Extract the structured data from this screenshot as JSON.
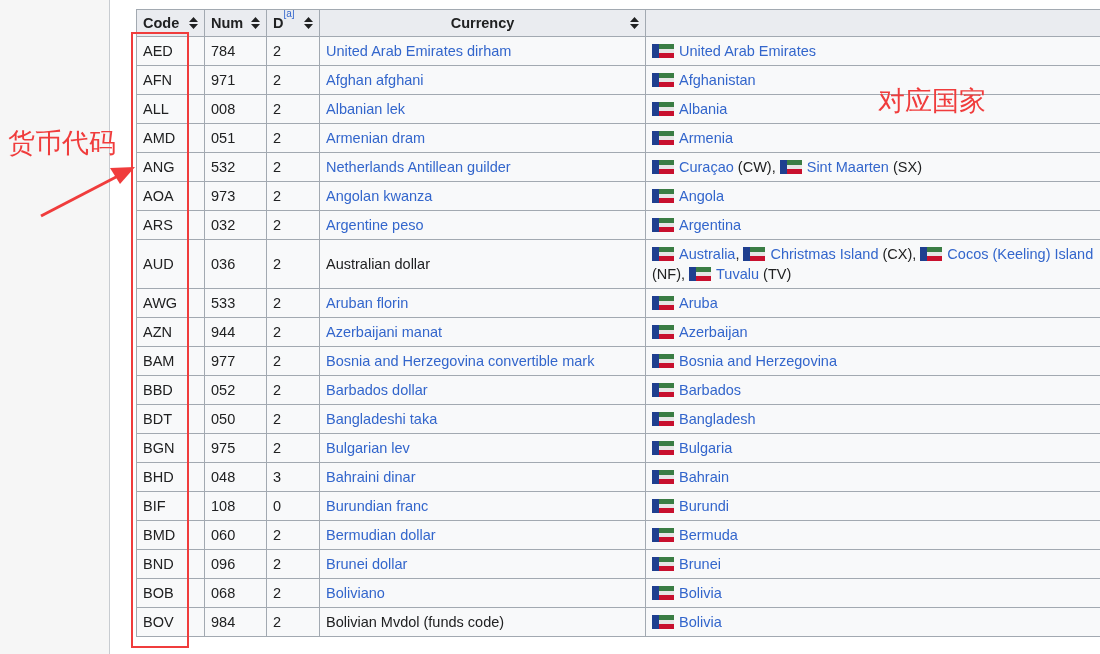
{
  "table": {
    "columns": [
      {
        "label": "Code",
        "sortable": true
      },
      {
        "label": "Num",
        "sortable": true
      },
      {
        "label": "D",
        "note": "[a]",
        "sortable": true
      },
      {
        "label": "Currency",
        "sortable": true
      },
      {
        "sortable": false
      }
    ],
    "rows": [
      {
        "code": "AED",
        "num": "784",
        "d": "2",
        "currency": "United Arab Emirates dirham",
        "link": true,
        "lines": [
          [
            {
              "name": "United Arab Emirates"
            }
          ]
        ]
      },
      {
        "code": "AFN",
        "num": "971",
        "d": "2",
        "currency": "Afghan afghani",
        "link": true,
        "lines": [
          [
            {
              "name": "Afghanistan"
            }
          ]
        ]
      },
      {
        "code": "ALL",
        "num": "008",
        "d": "2",
        "currency": "Albanian lek",
        "link": true,
        "lines": [
          [
            {
              "name": "Albania"
            }
          ]
        ]
      },
      {
        "code": "AMD",
        "num": "051",
        "d": "2",
        "currency": "Armenian dram",
        "link": true,
        "lines": [
          [
            {
              "name": "Armenia"
            }
          ]
        ]
      },
      {
        "code": "ANG",
        "num": "532",
        "d": "2",
        "currency": "Netherlands Antillean guilder",
        "link": true,
        "lines": [
          [
            {
              "name": "Curaçao",
              "note": "(CW)",
              "sep": ","
            },
            {
              "name": "Sint Maarten",
              "note": "(SX)"
            }
          ]
        ]
      },
      {
        "code": "AOA",
        "num": "973",
        "d": "2",
        "currency": "Angolan kwanza",
        "link": true,
        "lines": [
          [
            {
              "name": "Angola"
            }
          ]
        ]
      },
      {
        "code": "ARS",
        "num": "032",
        "d": "2",
        "currency": "Argentine peso",
        "link": true,
        "lines": [
          [
            {
              "name": "Argentina"
            }
          ]
        ]
      },
      {
        "code": "AUD",
        "num": "036",
        "d": "2",
        "currency": "Australian dollar",
        "link": false,
        "lines": [
          [
            {
              "name": "Australia",
              "sep": ","
            },
            {
              "name": "Christmas Island",
              "note": "(CX)",
              "sep": ","
            },
            {
              "name": "Cocos (Keeling) Island"
            }
          ],
          [
            {
              "note": "(NF)",
              "sep": ","
            },
            {
              "name": "Tuvalu",
              "note": "(TV)"
            }
          ]
        ]
      },
      {
        "code": "AWG",
        "num": "533",
        "d": "2",
        "currency": "Aruban florin",
        "link": true,
        "lines": [
          [
            {
              "name": "Aruba"
            }
          ]
        ]
      },
      {
        "code": "AZN",
        "num": "944",
        "d": "2",
        "currency": "Azerbaijani manat",
        "link": true,
        "lines": [
          [
            {
              "name": "Azerbaijan"
            }
          ]
        ]
      },
      {
        "code": "BAM",
        "num": "977",
        "d": "2",
        "currency": "Bosnia and Herzegovina convertible mark",
        "link": true,
        "lines": [
          [
            {
              "name": "Bosnia and Herzegovina"
            }
          ]
        ]
      },
      {
        "code": "BBD",
        "num": "052",
        "d": "2",
        "currency": "Barbados dollar",
        "link": true,
        "lines": [
          [
            {
              "name": "Barbados"
            }
          ]
        ]
      },
      {
        "code": "BDT",
        "num": "050",
        "d": "2",
        "currency": "Bangladeshi taka",
        "link": true,
        "lines": [
          [
            {
              "name": "Bangladesh"
            }
          ]
        ]
      },
      {
        "code": "BGN",
        "num": "975",
        "d": "2",
        "currency": "Bulgarian lev",
        "link": true,
        "lines": [
          [
            {
              "name": "Bulgaria"
            }
          ]
        ]
      },
      {
        "code": "BHD",
        "num": "048",
        "d": "3",
        "currency": "Bahraini dinar",
        "link": true,
        "lines": [
          [
            {
              "name": "Bahrain"
            }
          ]
        ]
      },
      {
        "code": "BIF",
        "num": "108",
        "d": "0",
        "currency": "Burundian franc",
        "link": true,
        "lines": [
          [
            {
              "name": "Burundi"
            }
          ]
        ]
      },
      {
        "code": "BMD",
        "num": "060",
        "d": "2",
        "currency": "Bermudian dollar",
        "link": true,
        "lines": [
          [
            {
              "name": "Bermuda"
            }
          ]
        ]
      },
      {
        "code": "BND",
        "num": "096",
        "d": "2",
        "currency": "Brunei dollar",
        "link": true,
        "lines": [
          [
            {
              "name": "Brunei"
            }
          ]
        ]
      },
      {
        "code": "BOB",
        "num": "068",
        "d": "2",
        "currency": "Boliviano",
        "link": true,
        "lines": [
          [
            {
              "name": "Bolivia"
            }
          ]
        ]
      },
      {
        "code": "BOV",
        "num": "984",
        "d": "2",
        "currency": "Bolivian Mvdol (funds code)",
        "link": false,
        "lines": [
          [
            {
              "name": "Bolivia"
            }
          ]
        ]
      }
    ]
  },
  "annotations": {
    "code_label": "货币代码",
    "country_label": "对应国家"
  }
}
